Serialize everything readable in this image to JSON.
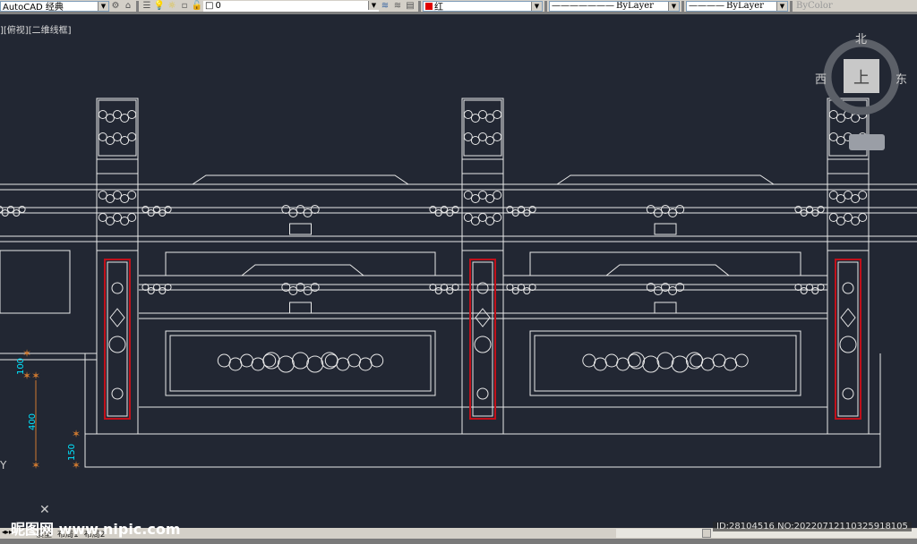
{
  "toolbar": {
    "workspace": "AutoCAD 经典",
    "layer": "0",
    "color": "红",
    "color_swatch": "#e00000",
    "linetype": "ByLayer",
    "lineweight": "ByLayer",
    "plotstyle": "ByColor"
  },
  "viewport": {
    "label": "][俯视][二维线框]"
  },
  "viewcube": {
    "north": "北",
    "south_top": "上",
    "west": "西",
    "east": "东"
  },
  "dimensions": [
    {
      "value": "100"
    },
    {
      "value": "400"
    },
    {
      "value": "150"
    }
  ],
  "ucs": {
    "y_label": "Y"
  },
  "tabs": [
    "模型",
    "布局1",
    "布局2"
  ],
  "watermark": {
    "logo": "昵图网",
    "url": "www.nipic.com"
  },
  "image_id": "ID:28104516 NO:20220712110325918105",
  "colors": {
    "background": "#222733",
    "lines": "#e8e8e8",
    "highlight": "#c0101a",
    "dim_text": "#00e5ff",
    "dim_mark": "#d07a30"
  }
}
